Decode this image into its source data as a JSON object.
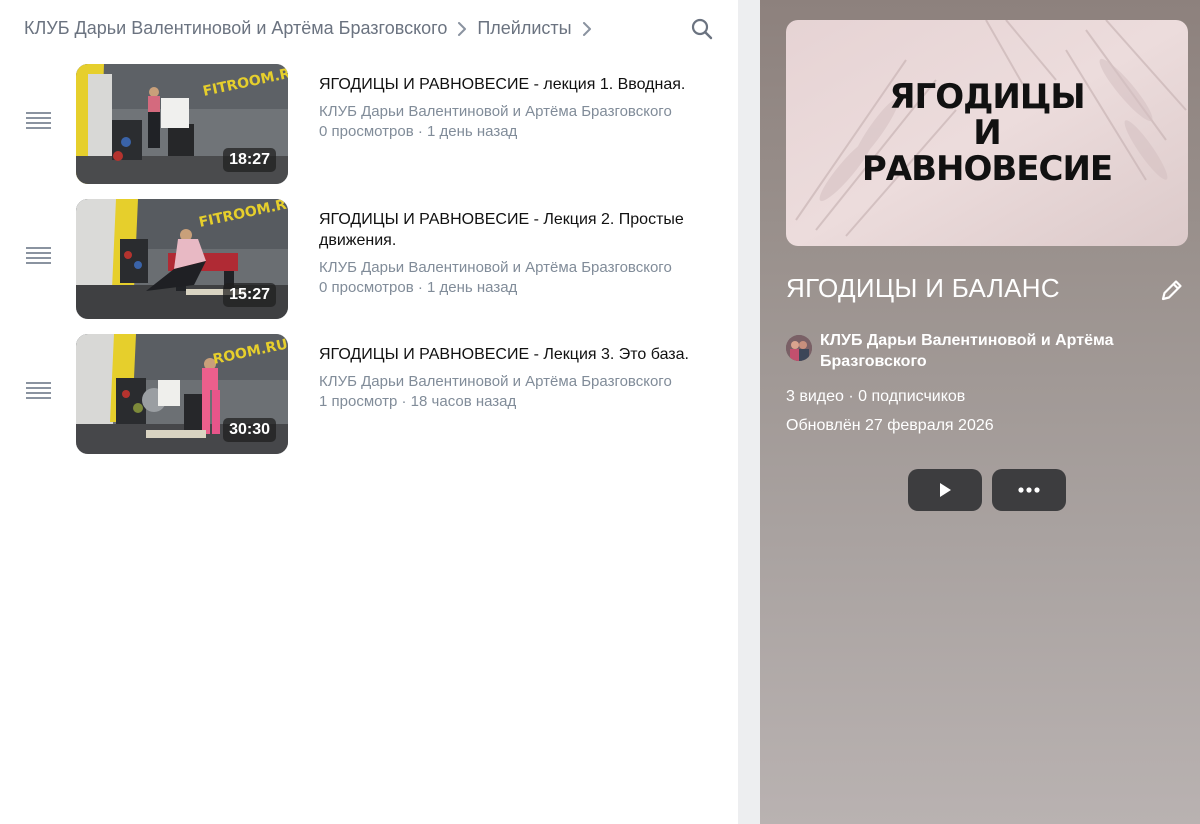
{
  "breadcrumb": {
    "items": [
      "КЛУБ Дарьи Валентиновой и Артёма Бразговского",
      "Плейлисты"
    ]
  },
  "videos": [
    {
      "title": "ЯГОДИЦЫ И РАВНОВЕСИЕ - лекция 1. Вводная.",
      "channel": "КЛУБ Дарьи Валентиновой и Артёма Бразговского",
      "stats": "0 просмотров · 1 день назад",
      "duration": "18:27"
    },
    {
      "title": "ЯГОДИЦЫ И РАВНОВЕСИЕ - Лекция 2. Простые движения.",
      "channel": "КЛУБ Дарьи Валентиновой и Артёма Бразговского",
      "stats": "0 просмотров · 1 день назад",
      "duration": "15:27"
    },
    {
      "title": "ЯГОДИЦЫ И РАВНОВЕСИЕ - Лекция 3. Это база.",
      "channel": "КЛУБ Дарьи Валентиновой и Артёма Бразговского",
      "stats": "1 просмотр · 18 часов назад",
      "duration": "30:30"
    }
  ],
  "thumb_watermark": [
    "FITROOM.RU",
    "FITROOM.RU",
    "ROOM.RU"
  ],
  "playlist": {
    "cover_lines": [
      "ЯГОДИЦЫ",
      "И",
      "РАВНОВЕСИЕ"
    ],
    "title": "ЯГОДИЦЫ И БАЛАНС",
    "owner": "КЛУБ Дарьи Валентиновой и Артёма Бразговского",
    "stats": "3 видео · 0 подписчиков",
    "updated": "Обновлён 27 февраля 2026"
  },
  "colors": {
    "accent_yellow": "#f2d21b",
    "secondary_text": "#818c99",
    "button_dark": "#3d3d3f"
  },
  "icons": {
    "search": "search-icon",
    "chevron": "chevron-right-icon",
    "drag": "drag-handle-icon",
    "edit": "pencil-icon",
    "play": "play-icon",
    "more": "more-dots-icon"
  }
}
